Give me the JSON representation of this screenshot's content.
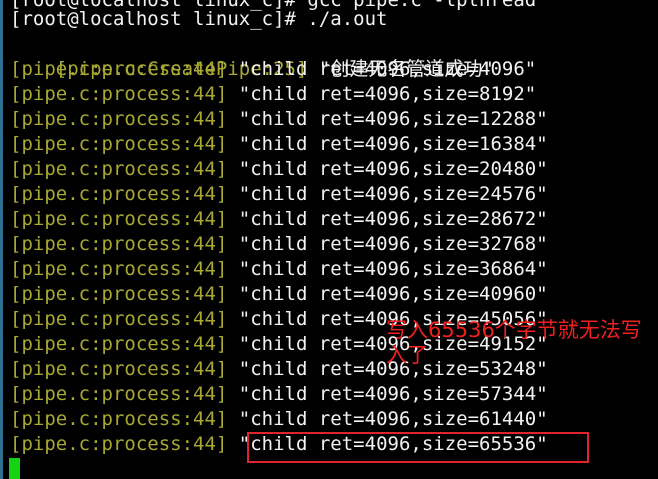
{
  "terminal": {
    "top_partial_command": "[root@localhost linux_c]# gcc pipe.c -lpthread",
    "prompt": "[root@localhost linux_c]# ./a.out",
    "create_prefix": "[pipe.c:CreatePipe:25]",
    "create_message": "\"创建无名管道成功\"",
    "process_prefix": "[pipe.c:process:44]",
    "messages": [
      "\"child ret=4096,size=4096\"",
      "\"child ret=4096,size=8192\"",
      "\"child ret=4096,size=12288\"",
      "\"child ret=4096,size=16384\"",
      "\"child ret=4096,size=20480\"",
      "\"child ret=4096,size=24576\"",
      "\"child ret=4096,size=28672\"",
      "\"child ret=4096,size=32768\"",
      "\"child ret=4096,size=36864\"",
      "\"child ret=4096,size=40960\"",
      "\"child ret=4096,size=45056\"",
      "\"child ret=4096,size=49152\"",
      "\"child ret=4096,size=53248\"",
      "\"child ret=4096,size=57344\"",
      "\"child ret=4096,size=61440\"",
      "\"child ret=4096,size=65536\""
    ],
    "annotation": "写入65536个字节就无法写入了"
  },
  "colors": {
    "background": "#000000",
    "prefix": "#a8a832",
    "text": "#f2f2f2",
    "cursor": "#12d412",
    "annotation": "#f02020"
  }
}
